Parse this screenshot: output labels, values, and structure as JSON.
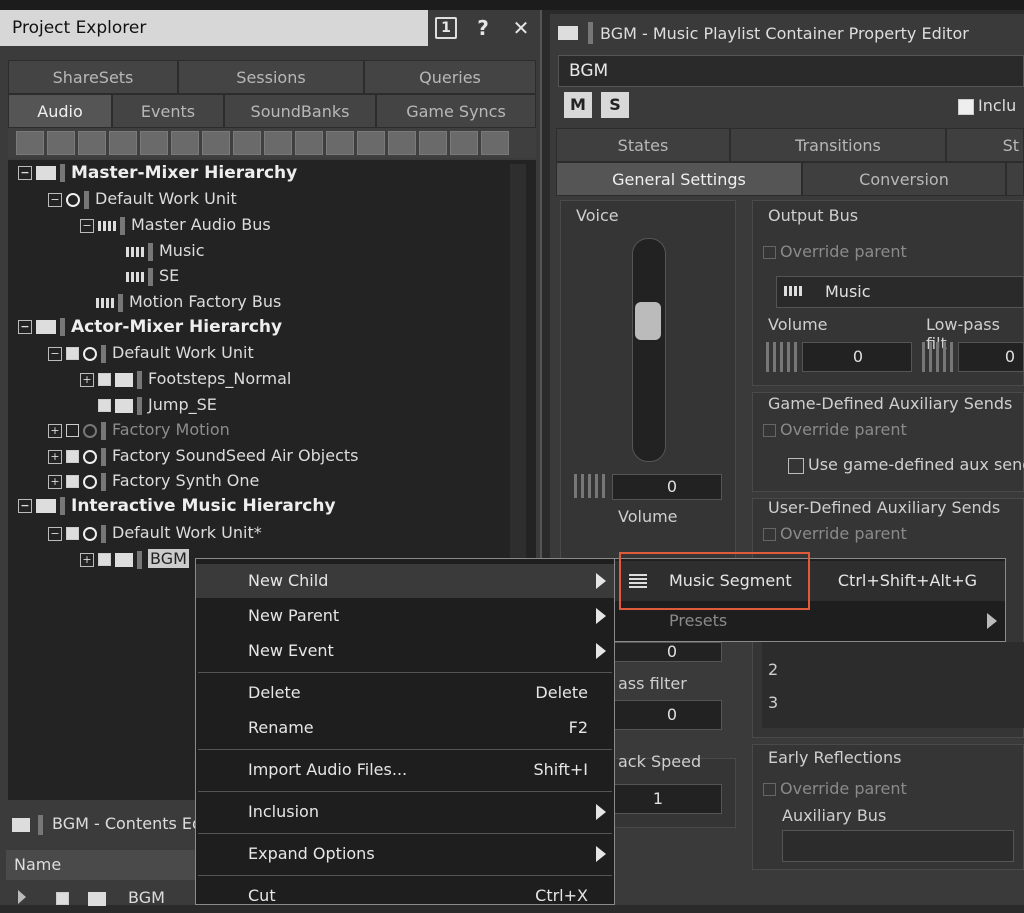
{
  "project_explorer": {
    "title": "Project Explorer",
    "title_buttons": [
      "1",
      "?",
      "✕"
    ],
    "tabs_row1": [
      "ShareSets",
      "Sessions",
      "Queries"
    ],
    "tabs_row2": [
      "Audio",
      "Events",
      "SoundBanks",
      "Game Syncs"
    ],
    "active_tab": "Audio",
    "tree": [
      {
        "label": "Master-Mixer Hierarchy",
        "level": 0,
        "type": "folder",
        "bold": true
      },
      {
        "label": "Default Work Unit",
        "level": 1,
        "type": "workunit"
      },
      {
        "label": "Master Audio Bus",
        "level": 2,
        "type": "bus"
      },
      {
        "label": "Music",
        "level": 3,
        "type": "bus"
      },
      {
        "label": "SE",
        "level": 3,
        "type": "bus"
      },
      {
        "label": "Motion Factory Bus",
        "level": 2,
        "type": "bus"
      },
      {
        "label": "Actor-Mixer Hierarchy",
        "level": 0,
        "type": "folder",
        "bold": true
      },
      {
        "label": "Default Work Unit",
        "level": 1,
        "type": "workunit"
      },
      {
        "label": "Footsteps_Normal",
        "level": 2,
        "type": "container"
      },
      {
        "label": "Jump_SE",
        "level": 2,
        "type": "sound"
      },
      {
        "label": "Factory Motion",
        "level": 1,
        "type": "workunit",
        "dim": true
      },
      {
        "label": "Factory SoundSeed Air Objects",
        "level": 1,
        "type": "workunit"
      },
      {
        "label": "Factory Synth One",
        "level": 1,
        "type": "workunit"
      },
      {
        "label": "Interactive Music Hierarchy",
        "level": 0,
        "type": "folder",
        "bold": true
      },
      {
        "label": "Default Work Unit*",
        "level": 1,
        "type": "workunit"
      },
      {
        "label": "BGM",
        "level": 2,
        "type": "playlist"
      }
    ]
  },
  "contents_editor": {
    "title": "BGM - Contents Ed",
    "column_name": "Name",
    "row_label": "BGM"
  },
  "property_editor": {
    "title": "BGM - Music Playlist Container Property Editor",
    "name_value": "BGM",
    "mute_label": "M",
    "solo_label": "S",
    "inclusion_label": "Inclu",
    "tabs_row1": [
      "States",
      "Transitions",
      "St"
    ],
    "tabs_row2": [
      "General Settings",
      "Conversion"
    ],
    "active_tab": "General Settings",
    "voice_label": "Voice",
    "voice_volume_value": "0",
    "voice_volume_label": "Volume",
    "output_bus": {
      "label": "Output Bus",
      "override": "Override parent",
      "bus_value": "Music",
      "volume_label": "Volume",
      "lowpass_label": "Low-pass filt",
      "volume_value": "0",
      "lowpass_value": "0"
    },
    "game_aux": {
      "label": "Game-Defined Auxiliary Sends",
      "override": "Override parent",
      "use_label": "Use game-defined aux send"
    },
    "user_aux": {
      "label": "User-Defined Auxiliary Sends",
      "override": "Override parent",
      "rows": [
        "2",
        "3"
      ]
    },
    "partial_field_value": "0",
    "lowpass_partial_label": "ass filter",
    "lowpass_partial_value": "0",
    "speed_label": "ack Speed",
    "speed_value": "1",
    "early_reflections": {
      "label": "Early Reflections",
      "override": "Override parent",
      "aux_bus_label": "Auxiliary Bus"
    }
  },
  "context_menu": {
    "items": [
      {
        "label": "New Child",
        "shortcut": "",
        "submenu": true,
        "highlight": true
      },
      {
        "label": "New Parent",
        "shortcut": "",
        "submenu": true
      },
      {
        "label": "New Event",
        "shortcut": "",
        "submenu": true
      },
      {
        "label": "Delete",
        "shortcut": "Delete",
        "submenu": false
      },
      {
        "label": "Rename",
        "shortcut": "F2",
        "submenu": false
      },
      {
        "label": "Import Audio Files...",
        "shortcut": "Shift+I",
        "submenu": false
      },
      {
        "label": "Inclusion",
        "shortcut": "",
        "submenu": true
      },
      {
        "label": "Expand Options",
        "shortcut": "",
        "submenu": true
      },
      {
        "label": "Cut",
        "shortcut": "Ctrl+X",
        "submenu": false
      }
    ]
  },
  "submenu": {
    "items": [
      {
        "label": "Music Segment",
        "shortcut": "Ctrl+Shift+Alt+G",
        "icon": "music-segment-icon",
        "highlight": true
      },
      {
        "label": "Presets",
        "shortcut": "",
        "submenu": true,
        "dim": true
      }
    ]
  },
  "colors": {
    "highlight_border": "#e05a3c",
    "title_bar_active": "#d7d7d7",
    "menu_bg": "#1e1e1e"
  }
}
